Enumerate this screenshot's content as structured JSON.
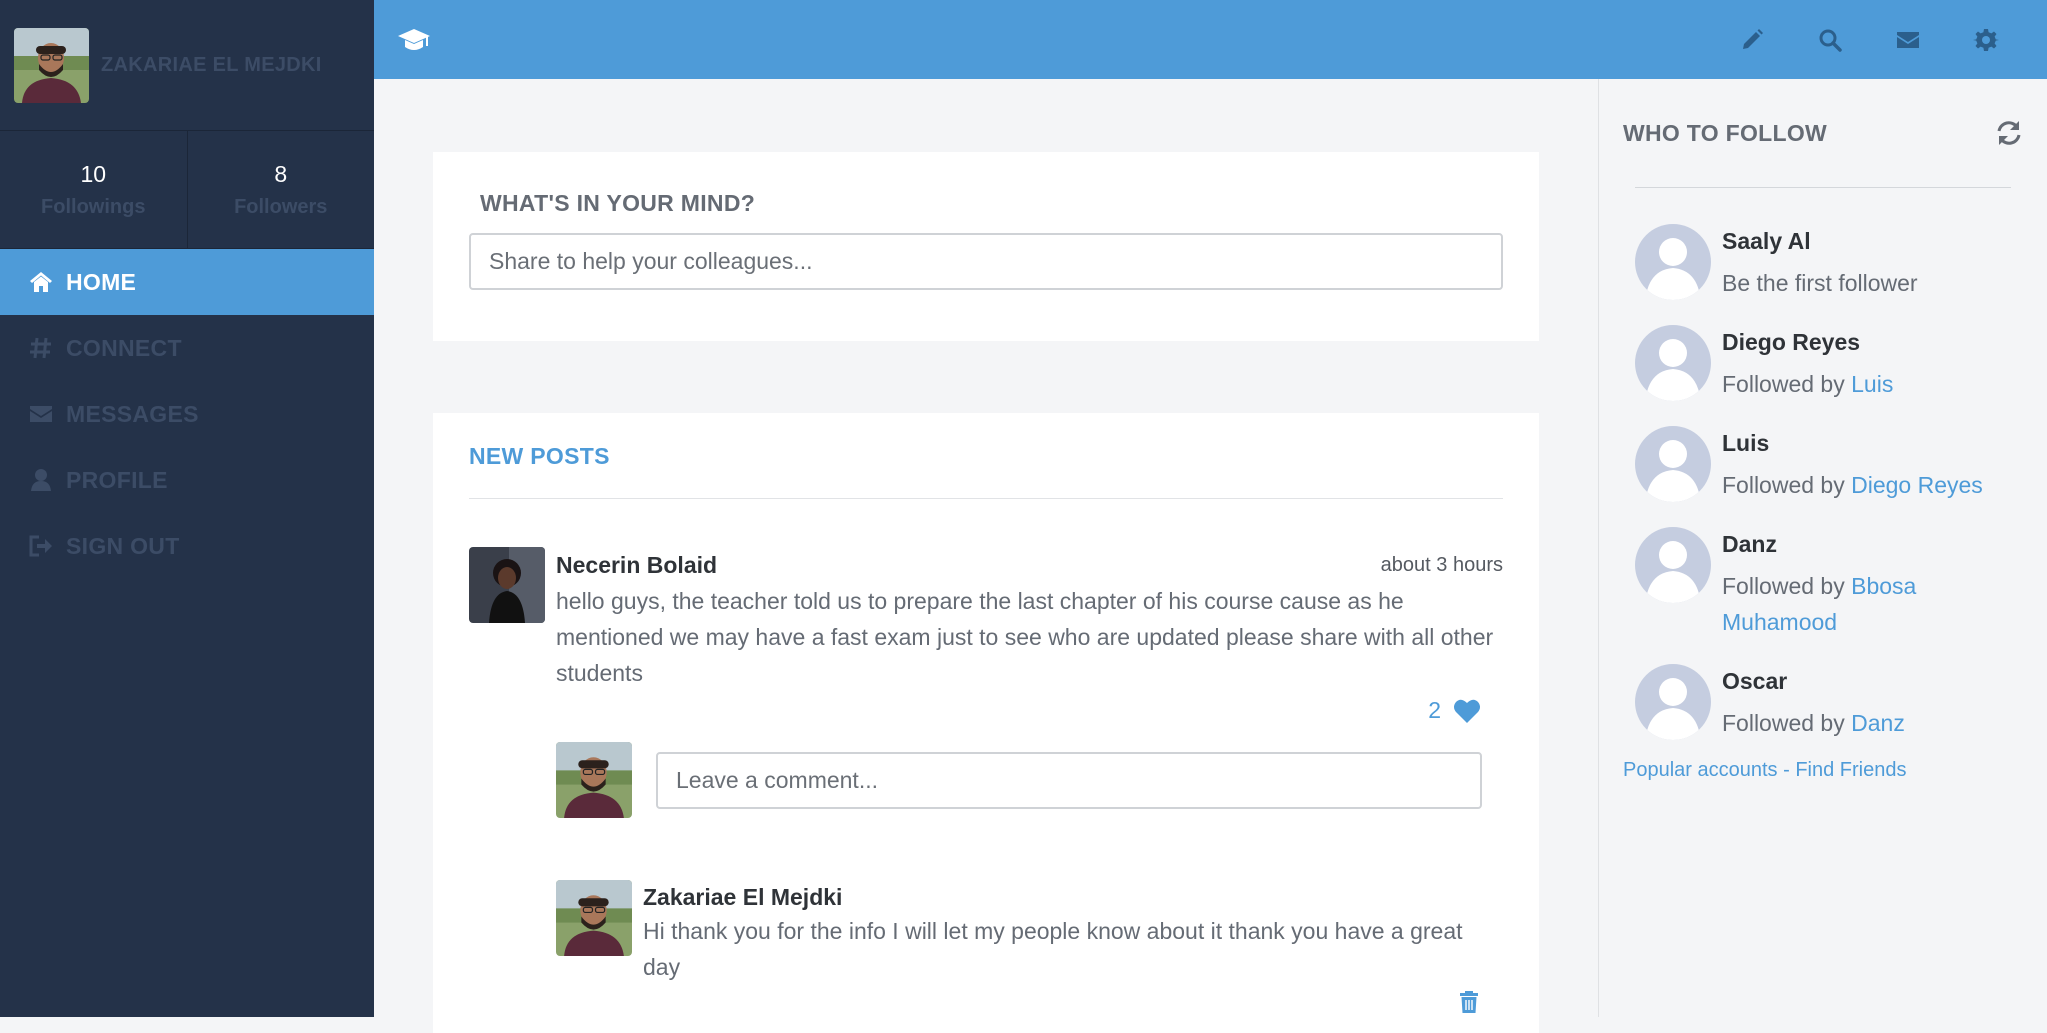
{
  "sidebar": {
    "username": "ZAKARIAE EL MEJDKI",
    "stats": [
      {
        "value": "10",
        "label": "Followings"
      },
      {
        "value": "8",
        "label": "Followers"
      }
    ],
    "nav": [
      {
        "label": "HOME",
        "icon": "home-icon"
      },
      {
        "label": "CONNECT",
        "icon": "hashtag-icon"
      },
      {
        "label": "MESSAGES",
        "icon": "envelope-icon"
      },
      {
        "label": "PROFILE",
        "icon": "user-icon"
      },
      {
        "label": "SIGN OUT",
        "icon": "sign-out-icon"
      }
    ]
  },
  "topbar": {
    "actions": [
      "pencil-icon",
      "search-icon",
      "envelope-icon",
      "gear-icon"
    ]
  },
  "compose": {
    "title": "WHAT'S IN YOUR MIND?",
    "placeholder": "Share to help your colleagues..."
  },
  "posts": {
    "title": "NEW POSTS",
    "items": [
      {
        "author": "Necerin Bolaid",
        "time": "about 3 hours",
        "text": "hello guys, the teacher told us to prepare the last chapter of his course cause as he mentioned we may have a fast exam just to see who are updated please share with all other students",
        "likes": "2",
        "comment_placeholder": "Leave a comment...",
        "replies": [
          {
            "author": "Zakariae El Mejdki",
            "text": "Hi thank you for the info I will let my people know about it thank you have a great day"
          }
        ]
      }
    ]
  },
  "who_to_follow": {
    "title": "WHO TO FOLLOW",
    "items": [
      {
        "name": "Saaly Al",
        "prefix": "Be the first follower",
        "link": ""
      },
      {
        "name": "Diego Reyes",
        "prefix": "Followed by ",
        "link": "Luis"
      },
      {
        "name": "Luis",
        "prefix": "Followed by ",
        "link": "Diego Reyes"
      },
      {
        "name": "Danz",
        "prefix": "Followed by ",
        "link": "Bbosa Muhamood"
      },
      {
        "name": "Oscar",
        "prefix": "Followed by ",
        "link": "Danz"
      }
    ],
    "footer": "Popular accounts - Find Friends"
  },
  "colors": {
    "accent": "#4e9bd8",
    "sidebar_bg": "#243249",
    "sidebar_text": "#3c4c66"
  }
}
